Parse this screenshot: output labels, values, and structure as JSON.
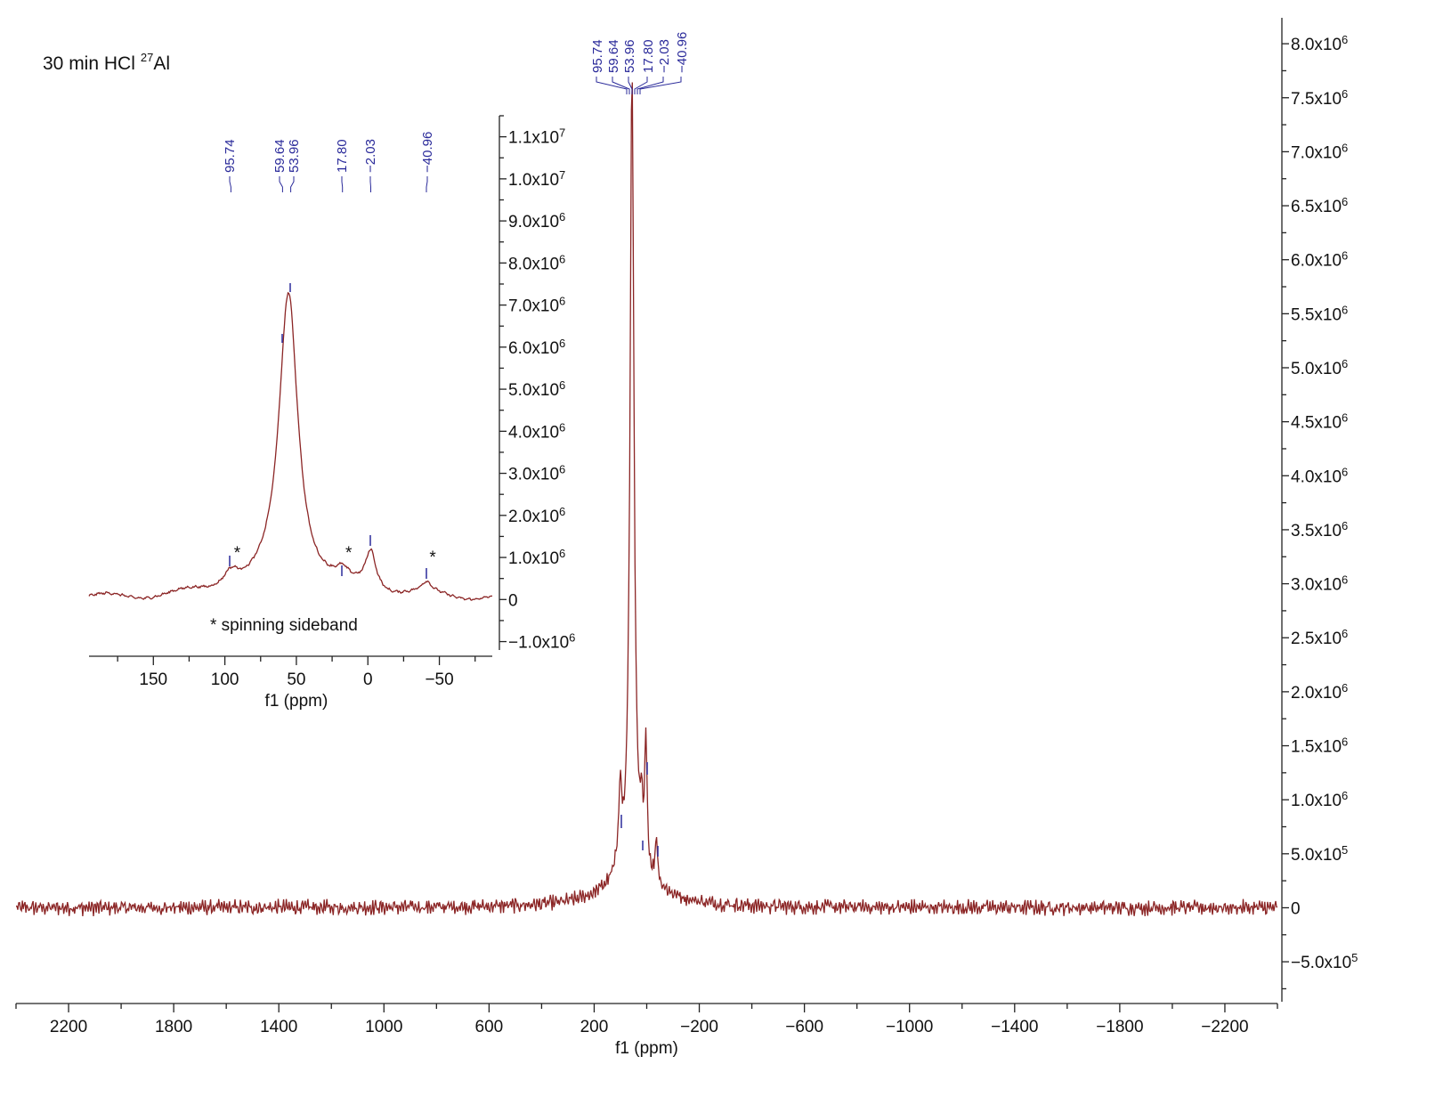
{
  "chart_data": [
    {
      "type": "line",
      "name": "main-spectrum",
      "title": "30 min HCl",
      "title_isotope_mass": "27",
      "title_isotope": "Al",
      "xlabel": "f1 (ppm)",
      "xlim": [
        2400,
        -2400
      ],
      "ylim": [
        -870000,
        8240000
      ],
      "x_ticks": [
        2200,
        1800,
        1400,
        1000,
        600,
        200,
        -200,
        -600,
        -1000,
        -1400,
        -1800,
        -2200
      ],
      "x_tick_labels": [
        "2200",
        "1800",
        "1400",
        "1000",
        "600",
        "200",
        "−200",
        "−600",
        "−1000",
        "−1400",
        "−1800",
        "−2200"
      ],
      "y_ticks": [
        8000000,
        7500000,
        7000000,
        6500000,
        6000000,
        5500000,
        5000000,
        4500000,
        4000000,
        3500000,
        3000000,
        2500000,
        2000000,
        1500000,
        1000000,
        500000,
        0,
        -500000
      ],
      "y_tick_labels": [
        {
          "m": "8.0x10",
          "e": "6"
        },
        {
          "m": "7.5x10",
          "e": "6"
        },
        {
          "m": "7.0x10",
          "e": "6"
        },
        {
          "m": "6.5x10",
          "e": "6"
        },
        {
          "m": "6.0x10",
          "e": "6"
        },
        {
          "m": "5.5x10",
          "e": "6"
        },
        {
          "m": "5.0x10",
          "e": "6"
        },
        {
          "m": "4.5x10",
          "e": "6"
        },
        {
          "m": "4.0x10",
          "e": "6"
        },
        {
          "m": "3.5x10",
          "e": "6"
        },
        {
          "m": "3.0x10",
          "e": "6"
        },
        {
          "m": "2.5x10",
          "e": "6"
        },
        {
          "m": "2.0x10",
          "e": "6"
        },
        {
          "m": "1.5x10",
          "e": "6"
        },
        {
          "m": "1.0x10",
          "e": "6"
        },
        {
          "m": "5.0x10",
          "e": "5"
        },
        {
          "m": "0",
          "e": ""
        },
        {
          "m": "−5.0x10",
          "e": "5"
        }
      ],
      "peak_labels": [
        "95.74",
        "59.64",
        "53.96",
        "17.80",
        "−2.03",
        "−40.96"
      ],
      "peaks": [
        {
          "ppm": 56,
          "intensity": 7490000,
          "width": 18
        },
        {
          "ppm": 101,
          "intensity": 750000,
          "width": 14
        },
        {
          "ppm": 20,
          "intensity": 450000,
          "width": 10
        },
        {
          "ppm": 3,
          "intensity": 1250000,
          "width": 10
        },
        {
          "ppm": -37,
          "intensity": 420000,
          "width": 10
        }
      ],
      "series_color": "#8b2525",
      "label_color": "#2a2a9a"
    },
    {
      "type": "line",
      "name": "inset-spectrum",
      "xlabel": "f1 (ppm)",
      "xlim": [
        195,
        -87
      ],
      "ylim": [
        -1200000,
        11500000
      ],
      "x_ticks": [
        150,
        100,
        50,
        0,
        -50
      ],
      "x_tick_labels": [
        "150",
        "100",
        "50",
        "0",
        "−50"
      ],
      "y_ticks": [
        11000000,
        10000000,
        9000000,
        8000000,
        7000000,
        6000000,
        5000000,
        4000000,
        3000000,
        2000000,
        1000000,
        0,
        -1000000
      ],
      "y_tick_labels": [
        {
          "m": "1.1x10",
          "e": "7"
        },
        {
          "m": "1.0x10",
          "e": "7"
        },
        {
          "m": "9.0x10",
          "e": "6"
        },
        {
          "m": "8.0x10",
          "e": "6"
        },
        {
          "m": "7.0x10",
          "e": "6"
        },
        {
          "m": "6.0x10",
          "e": "6"
        },
        {
          "m": "5.0x10",
          "e": "6"
        },
        {
          "m": "4.0x10",
          "e": "6"
        },
        {
          "m": "3.0x10",
          "e": "6"
        },
        {
          "m": "2.0x10",
          "e": "6"
        },
        {
          "m": "1.0x10",
          "e": "6"
        },
        {
          "m": "0",
          "e": ""
        },
        {
          "m": "−1.0x10",
          "e": "6"
        }
      ],
      "peak_labels": [
        "95.74",
        "59.64",
        "53.96",
        "17.80",
        "−2.03",
        "−40.96"
      ],
      "peak_ppm": [
        95.74,
        59.64,
        53.96,
        17.8,
        -2.03,
        -40.96
      ],
      "peaks": [
        {
          "ppm": 55.5,
          "intensity": 7050000,
          "width": 16
        },
        {
          "ppm": 95.74,
          "intensity": 420000,
          "width": 14
        },
        {
          "ppm": 17.8,
          "intensity": 230000,
          "width": 10
        },
        {
          "ppm": -2.03,
          "intensity": 920000,
          "width": 9
        },
        {
          "ppm": -40.96,
          "intensity": 220000,
          "width": 8
        }
      ],
      "sideband_marker": "*",
      "sideband_ppm": [
        95.74,
        17.8,
        -40.96
      ],
      "annotation": "* spinning sideband",
      "series_color": "#8b2525",
      "label_color": "#2a2a9a"
    }
  ]
}
